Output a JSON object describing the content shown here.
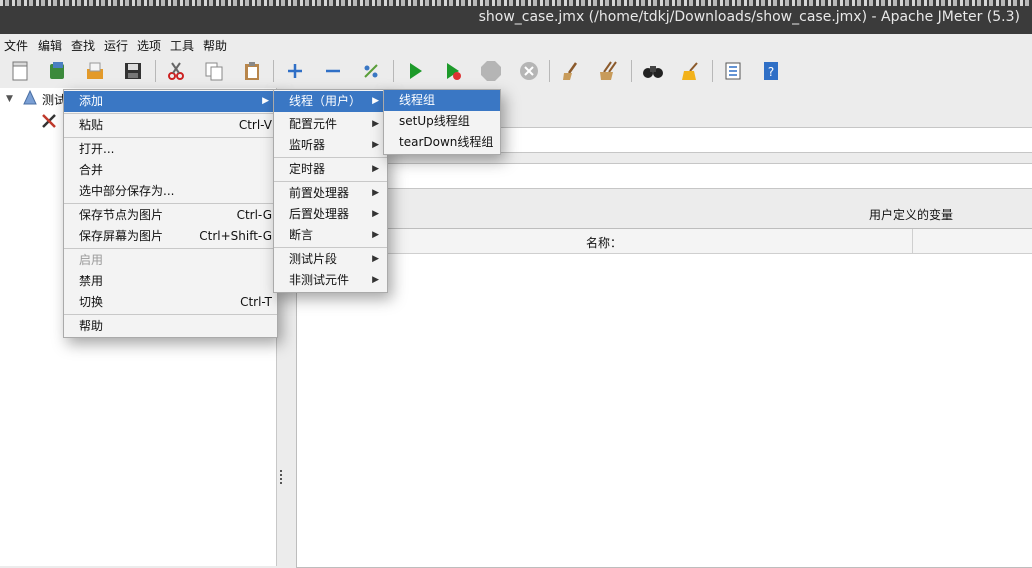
{
  "window": {
    "title": "show_case.jmx (/home/tdkj/Downloads/show_case.jmx) - Apache JMeter (5.3)"
  },
  "menubar": [
    "文件",
    "编辑",
    "查找",
    "运行",
    "选项",
    "工具",
    "帮助"
  ],
  "toolbar": {
    "icons": [
      "new-icon",
      "templates-icon",
      "open-icon",
      "save-icon",
      "cut-icon",
      "copy-icon",
      "paste-icon",
      "expand-icon",
      "collapse-icon",
      "toggle-icon",
      "start-icon",
      "start-no-pause-icon",
      "stop-icon",
      "shutdown-icon",
      "clear-icon",
      "clear-all-icon",
      "search-icon",
      "reset-search-icon",
      "function-helper-icon",
      "help-icon"
    ]
  },
  "tree": {
    "root_label": "测试"
  },
  "context_menu": {
    "items": [
      {
        "label": "添加",
        "has_submenu": true
      },
      {
        "label": "粘贴",
        "shortcut": "Ctrl-V"
      },
      {
        "label": "打开..."
      },
      {
        "label": "合并"
      },
      {
        "label": "选中部分保存为..."
      },
      {
        "label": "保存节点为图片",
        "shortcut": "Ctrl-G"
      },
      {
        "label": "保存屏幕为图片",
        "shortcut": "Ctrl+Shift-G"
      },
      {
        "label": "启用",
        "disabled": true
      },
      {
        "label": "禁用"
      },
      {
        "label": "切换",
        "shortcut": "Ctrl-T"
      },
      {
        "label": "帮助"
      }
    ]
  },
  "add_submenu": {
    "items": [
      {
        "label": "线程（用户）"
      },
      {
        "label": "配置元件"
      },
      {
        "label": "监听器"
      },
      {
        "label": "定时器"
      },
      {
        "label": "前置处理器"
      },
      {
        "label": "后置处理器"
      },
      {
        "label": "断言"
      },
      {
        "label": "测试片段"
      },
      {
        "label": "非测试元件"
      }
    ]
  },
  "threads_submenu": {
    "items": [
      {
        "label": "线程组"
      },
      {
        "label": "setUp线程组"
      },
      {
        "label": "tearDown线程组"
      }
    ]
  },
  "right_panel": {
    "user_vars_title": "用户定义的变量",
    "name_column": "名称："
  },
  "colors": {
    "selection": "#3a77c4",
    "titlebar": "#3b3b3b"
  }
}
